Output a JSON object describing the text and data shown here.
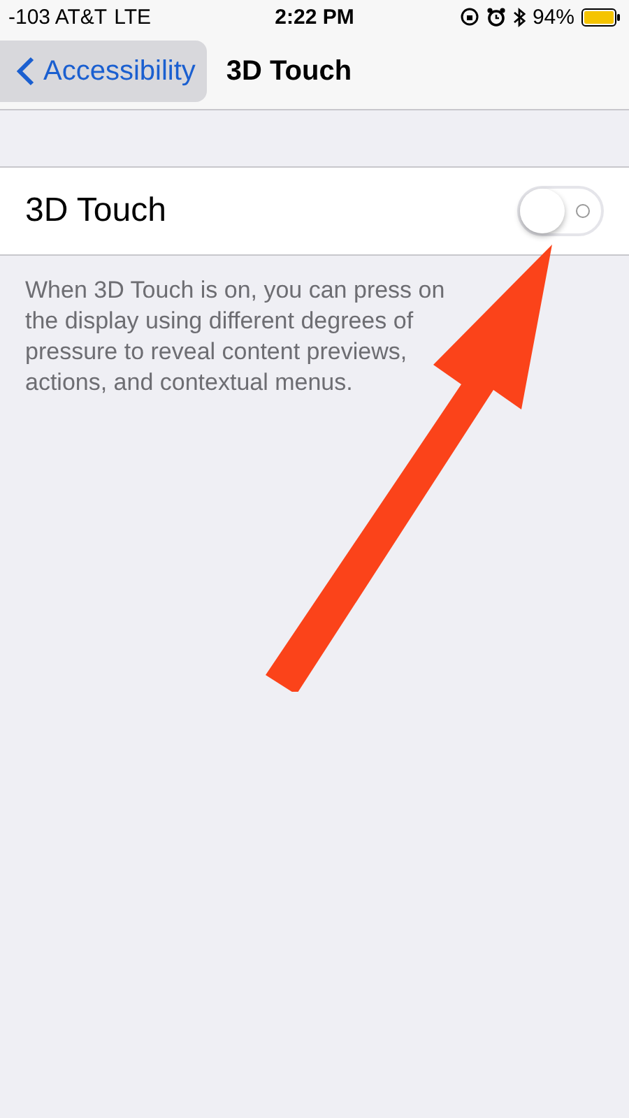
{
  "status_bar": {
    "carrier": "-103 AT&T",
    "network": "LTE",
    "time": "2:22 PM",
    "battery": "94%"
  },
  "nav": {
    "back": "Accessibility",
    "title": "3D Touch"
  },
  "setting": {
    "label": "3D Touch",
    "on": false
  },
  "footer": "When 3D Touch is on, you can press on the display using different degrees of pressure to reveal content previews, actions, and contextual menus."
}
